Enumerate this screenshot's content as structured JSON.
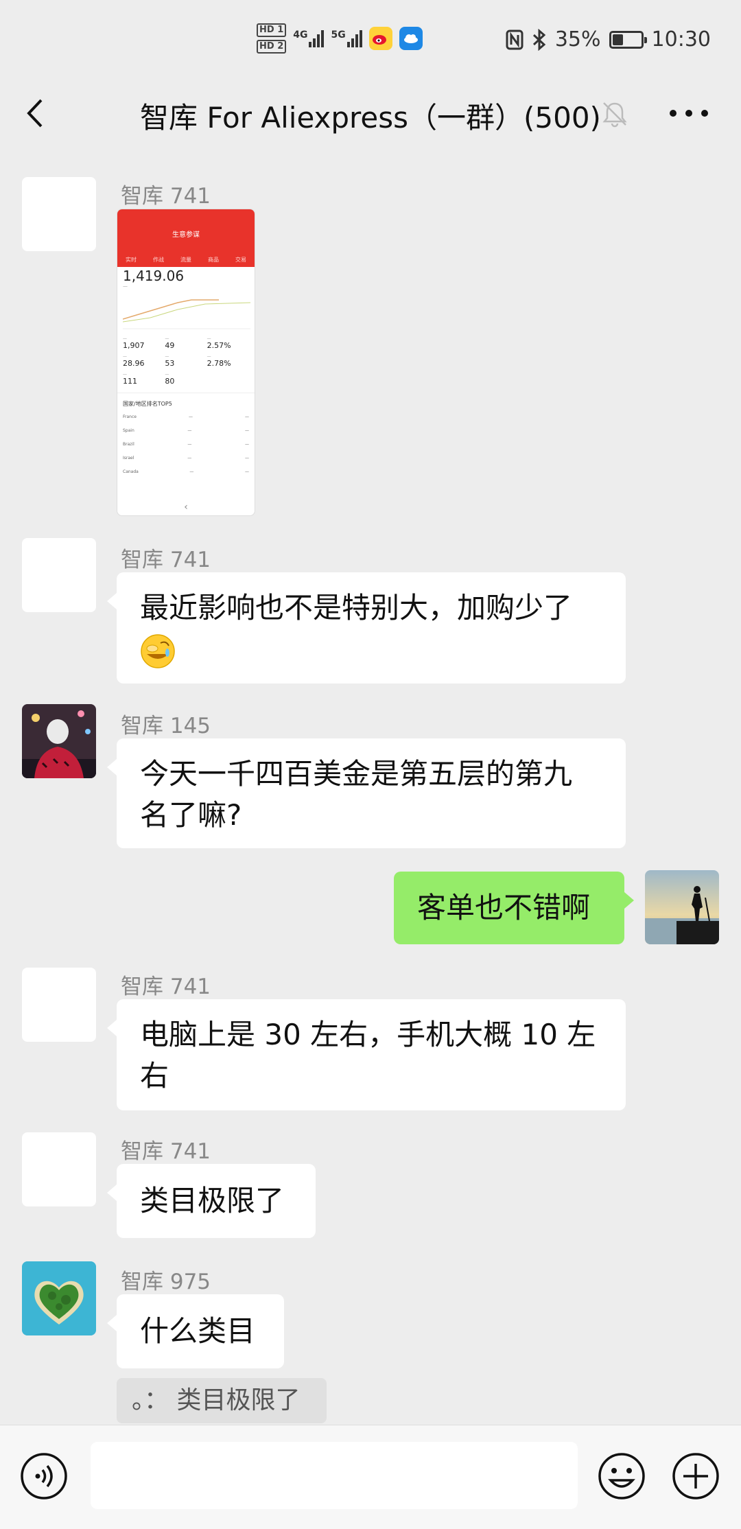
{
  "status_bar": {
    "hd1": "HD 1",
    "hd2": "HD 2",
    "net1": "4G",
    "net2": "5G",
    "battery_percent": "35%",
    "battery_level": 0.35,
    "time": "10:30"
  },
  "title_bar": {
    "title": "智库 For Aliexpress（一群）(500)"
  },
  "messages": [
    {
      "sender": "智库 741",
      "type": "image",
      "thumbnail": {
        "big_value": "1,419.06",
        "metrics": [
          {
            "value": "1,907"
          },
          {
            "value": "49"
          },
          {
            "value": "2.57%"
          },
          {
            "value": "28.96"
          },
          {
            "value": "53"
          },
          {
            "value": "2.78%"
          },
          {
            "value": "111"
          },
          {
            "value": "80"
          }
        ],
        "section_title": "国家/地区排名TOP5",
        "rows": [
          "France",
          "Spain",
          "Brazil",
          "Israel",
          "Canada"
        ]
      }
    },
    {
      "sender": "智库 741",
      "text": "最近影响也不是特别大，加购少了"
    },
    {
      "sender": "智库 145",
      "text_line1": "今天一千四百美金是第五层的第九",
      "text_line2": "名了嘛?"
    },
    {
      "self": true,
      "text": "客单也不错啊"
    },
    {
      "sender": "智库 741",
      "text_line1": "电脑上是 30 左右，手机大概 10 左",
      "text_line2": "右"
    },
    {
      "sender": "智库 741",
      "text": "类目极限了"
    },
    {
      "sender": "智库 975",
      "text": "什么类目"
    }
  ],
  "quote": {
    "text": "。：  类目极限了"
  },
  "colors": {
    "self_bubble": "#95ec69",
    "background": "#ededed"
  },
  "icons": {
    "back": "chevron-left-icon",
    "mute": "bell-off-icon",
    "more": "more-dots-icon",
    "voice": "voice-icon",
    "emoji": "emoji-icon",
    "plus": "plus-icon"
  }
}
